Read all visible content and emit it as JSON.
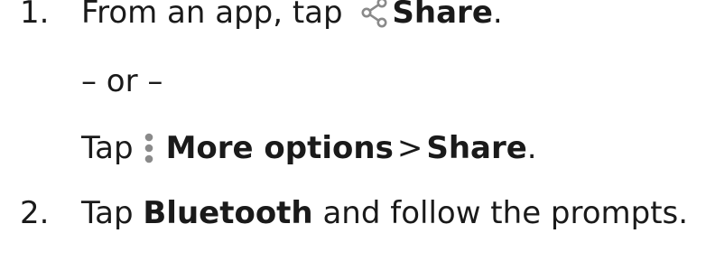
{
  "steps": [
    {
      "number": "1.",
      "text_before": "From an app, tap",
      "icon": "share-icon",
      "bold": "Share",
      "after": "."
    },
    {
      "number": "2.",
      "text_before": "Tap",
      "bold": "Bluetooth",
      "after": "and follow the prompts."
    }
  ],
  "alternative": {
    "separator": "– or –",
    "text_before": "Tap",
    "icon": "more-options-icon",
    "bold1": "More options",
    "chevron": ">",
    "bold2": "Share",
    "after": "."
  },
  "colors": {
    "text": "#1a1a1a",
    "icon": "#8a8a8a"
  }
}
